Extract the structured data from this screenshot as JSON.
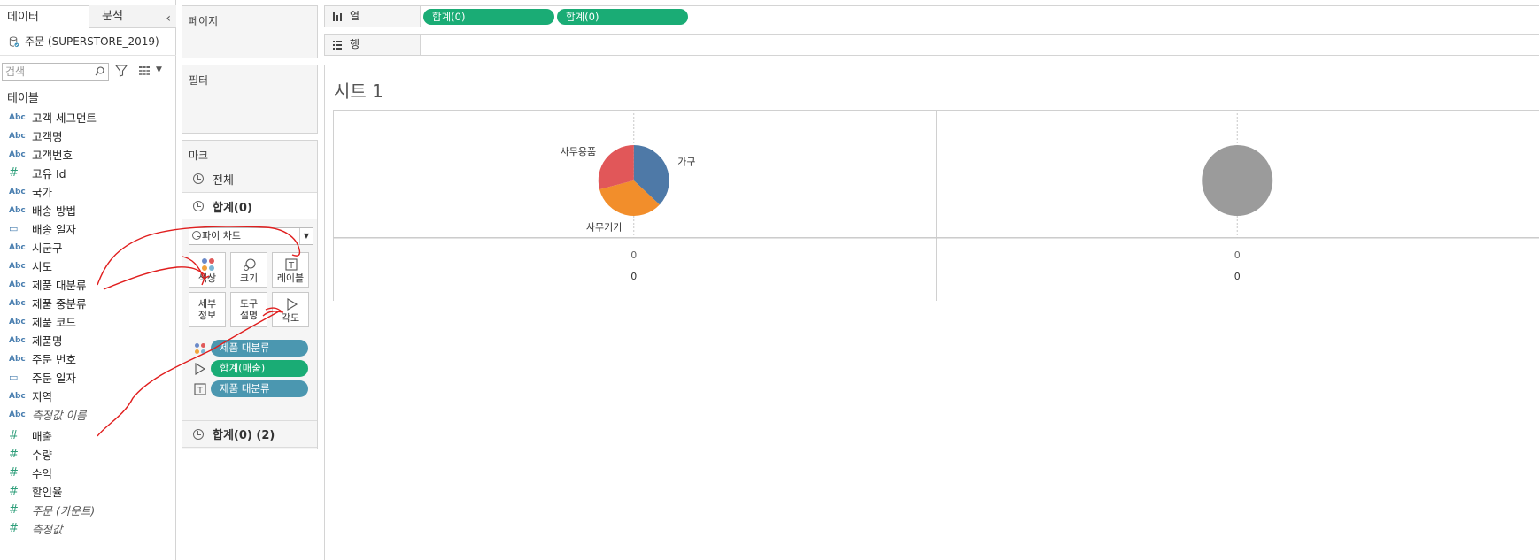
{
  "data_pane": {
    "tab_data": "데이터",
    "tab_analysis": "분석",
    "datasource": "주문 (SUPERSTORE_2019)",
    "search_placeholder": "검색",
    "section_title": "테이블",
    "dimensions": [
      {
        "type": "Abc",
        "name": "고객 세그먼트"
      },
      {
        "type": "Abc",
        "name": "고객명"
      },
      {
        "type": "Abc",
        "name": "고객번호"
      },
      {
        "type": "#",
        "name": "고유 Id"
      },
      {
        "type": "Abc",
        "name": "국가"
      },
      {
        "type": "Abc",
        "name": "배송 방법"
      },
      {
        "type": "cal",
        "name": "배송 일자"
      },
      {
        "type": "Abc",
        "name": "시군구"
      },
      {
        "type": "Abc",
        "name": "시도"
      },
      {
        "type": "Abc",
        "name": "제품 대분류"
      },
      {
        "type": "Abc",
        "name": "제품 중분류"
      },
      {
        "type": "Abc",
        "name": "제품 코드"
      },
      {
        "type": "Abc",
        "name": "제품명"
      },
      {
        "type": "Abc",
        "name": "주문 번호"
      },
      {
        "type": "cal",
        "name": "주문 일자"
      },
      {
        "type": "Abc",
        "name": "지역"
      },
      {
        "type": "Abc",
        "name": "측정값 이름",
        "italic": true
      }
    ],
    "measures": [
      {
        "type": "#",
        "name": "매출"
      },
      {
        "type": "#",
        "name": "수량"
      },
      {
        "type": "#",
        "name": "수익"
      },
      {
        "type": "#",
        "name": "할인율"
      },
      {
        "type": "#",
        "name": "주문 (카운트)",
        "italic": true
      },
      {
        "type": "#",
        "name": "측정값",
        "italic": true
      }
    ]
  },
  "shelves": {
    "pages": "페이지",
    "filters": "필터",
    "marks": "마크",
    "columns_label": "열",
    "rows_label": "행",
    "column_pills": [
      "합계(0)",
      "합계(0)"
    ]
  },
  "marks_card": {
    "all": "전체",
    "sum0": "합계(0)",
    "mark_type": "파이 차트",
    "buttons": {
      "color": "색상",
      "size": "크기",
      "label": "레이블",
      "detail": "세부\n정보",
      "tooltip": "도구\n설명",
      "angle": "각도"
    },
    "pills": [
      {
        "icon": "color-icon",
        "label": "제품 대분류",
        "color": "#4b97b0"
      },
      {
        "icon": "angle-icon",
        "label": "합계(매출)",
        "color": "#1aac75"
      },
      {
        "icon": "label-icon",
        "label": "제품 대분류",
        "color": "#4b97b0"
      }
    ],
    "sum0_2": "합계(0) (2)"
  },
  "view": {
    "sheet_title": "시트 1"
  },
  "chart_data": {
    "type": "pie",
    "panes": [
      {
        "slices": [
          {
            "label": "가구",
            "value": 37,
            "color": "#4e79a7"
          },
          {
            "label": "사무기기",
            "value": 34,
            "color": "#f28e2b"
          },
          {
            "label": "사무용품",
            "value": 29,
            "color": "#e15759"
          }
        ],
        "axis_tick": "0",
        "axis_value": "0"
      },
      {
        "slices": [
          {
            "label": "",
            "value": 100,
            "color": "#9b9b9b"
          }
        ],
        "axis_tick": "0",
        "axis_value": "0"
      }
    ]
  }
}
